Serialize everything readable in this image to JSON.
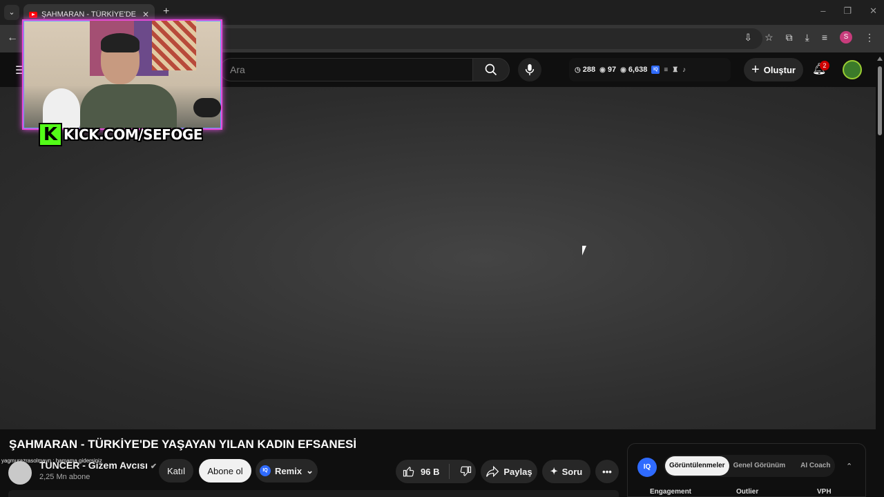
{
  "browser": {
    "tab_title": "ŞAHMARAN - TÜRKİYE'DE YAŞA",
    "tab_close": "✕",
    "new_tab": "+",
    "profile_initial": "S"
  },
  "header": {
    "search_placeholder": "Ara",
    "stats": {
      "time": "288",
      "watching": "97",
      "views": "6,638"
    },
    "create_label": "Oluştur",
    "notifications_count": "2"
  },
  "stream_overlay": {
    "kick_logo": "K",
    "kick_url": "KICK.COM/SEFOGE"
  },
  "video": {
    "title": "ŞAHMARAN - TÜRKİYE'DE YAŞAYAN YILAN KADIN EFSANESİ",
    "chat_overlay": "yagmurazrasolmayn : hamama gidersiniz",
    "channel_name": "TUNCER - Gizem Avcısı",
    "subscribers": "2,25 Mn abone",
    "join_label": "Katıl",
    "subscribe_label": "Abone ol",
    "remix_label": "Remix",
    "likes": "96 B",
    "share_label": "Paylaş",
    "ask_label": "Soru"
  },
  "iq_panel": {
    "logo": "IQ",
    "tabs": [
      "Görüntülenmeler",
      "Genel Görünüm",
      "AI Coach"
    ],
    "columns": [
      "Engagement",
      "Outlier",
      "VPH"
    ]
  },
  "colors": {
    "accent": "#ff0000",
    "kick_green": "#53fc18",
    "iq_blue": "#2f6bff",
    "frame_pink": "#e64bd6"
  }
}
